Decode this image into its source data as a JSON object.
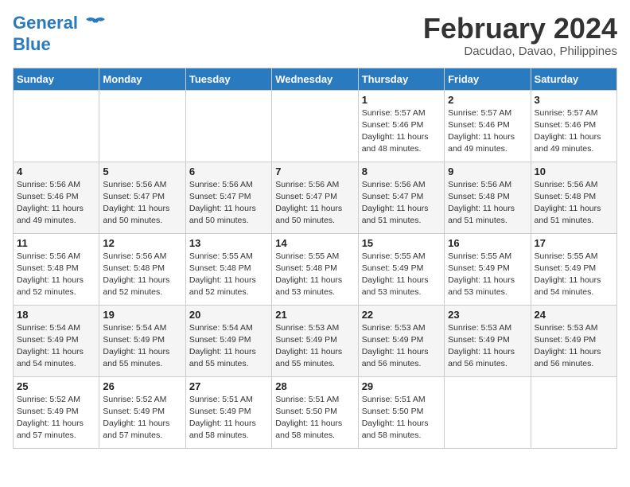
{
  "header": {
    "logo_line1": "General",
    "logo_line2": "Blue",
    "month_year": "February 2024",
    "location": "Dacudao, Davao, Philippines"
  },
  "weekdays": [
    "Sunday",
    "Monday",
    "Tuesday",
    "Wednesday",
    "Thursday",
    "Friday",
    "Saturday"
  ],
  "weeks": [
    [
      {
        "day": "",
        "detail": ""
      },
      {
        "day": "",
        "detail": ""
      },
      {
        "day": "",
        "detail": ""
      },
      {
        "day": "",
        "detail": ""
      },
      {
        "day": "1",
        "detail": "Sunrise: 5:57 AM\nSunset: 5:46 PM\nDaylight: 11 hours\nand 48 minutes."
      },
      {
        "day": "2",
        "detail": "Sunrise: 5:57 AM\nSunset: 5:46 PM\nDaylight: 11 hours\nand 49 minutes."
      },
      {
        "day": "3",
        "detail": "Sunrise: 5:57 AM\nSunset: 5:46 PM\nDaylight: 11 hours\nand 49 minutes."
      }
    ],
    [
      {
        "day": "4",
        "detail": "Sunrise: 5:56 AM\nSunset: 5:46 PM\nDaylight: 11 hours\nand 49 minutes."
      },
      {
        "day": "5",
        "detail": "Sunrise: 5:56 AM\nSunset: 5:47 PM\nDaylight: 11 hours\nand 50 minutes."
      },
      {
        "day": "6",
        "detail": "Sunrise: 5:56 AM\nSunset: 5:47 PM\nDaylight: 11 hours\nand 50 minutes."
      },
      {
        "day": "7",
        "detail": "Sunrise: 5:56 AM\nSunset: 5:47 PM\nDaylight: 11 hours\nand 50 minutes."
      },
      {
        "day": "8",
        "detail": "Sunrise: 5:56 AM\nSunset: 5:47 PM\nDaylight: 11 hours\nand 51 minutes."
      },
      {
        "day": "9",
        "detail": "Sunrise: 5:56 AM\nSunset: 5:48 PM\nDaylight: 11 hours\nand 51 minutes."
      },
      {
        "day": "10",
        "detail": "Sunrise: 5:56 AM\nSunset: 5:48 PM\nDaylight: 11 hours\nand 51 minutes."
      }
    ],
    [
      {
        "day": "11",
        "detail": "Sunrise: 5:56 AM\nSunset: 5:48 PM\nDaylight: 11 hours\nand 52 minutes."
      },
      {
        "day": "12",
        "detail": "Sunrise: 5:56 AM\nSunset: 5:48 PM\nDaylight: 11 hours\nand 52 minutes."
      },
      {
        "day": "13",
        "detail": "Sunrise: 5:55 AM\nSunset: 5:48 PM\nDaylight: 11 hours\nand 52 minutes."
      },
      {
        "day": "14",
        "detail": "Sunrise: 5:55 AM\nSunset: 5:48 PM\nDaylight: 11 hours\nand 53 minutes."
      },
      {
        "day": "15",
        "detail": "Sunrise: 5:55 AM\nSunset: 5:49 PM\nDaylight: 11 hours\nand 53 minutes."
      },
      {
        "day": "16",
        "detail": "Sunrise: 5:55 AM\nSunset: 5:49 PM\nDaylight: 11 hours\nand 53 minutes."
      },
      {
        "day": "17",
        "detail": "Sunrise: 5:55 AM\nSunset: 5:49 PM\nDaylight: 11 hours\nand 54 minutes."
      }
    ],
    [
      {
        "day": "18",
        "detail": "Sunrise: 5:54 AM\nSunset: 5:49 PM\nDaylight: 11 hours\nand 54 minutes."
      },
      {
        "day": "19",
        "detail": "Sunrise: 5:54 AM\nSunset: 5:49 PM\nDaylight: 11 hours\nand 55 minutes."
      },
      {
        "day": "20",
        "detail": "Sunrise: 5:54 AM\nSunset: 5:49 PM\nDaylight: 11 hours\nand 55 minutes."
      },
      {
        "day": "21",
        "detail": "Sunrise: 5:53 AM\nSunset: 5:49 PM\nDaylight: 11 hours\nand 55 minutes."
      },
      {
        "day": "22",
        "detail": "Sunrise: 5:53 AM\nSunset: 5:49 PM\nDaylight: 11 hours\nand 56 minutes."
      },
      {
        "day": "23",
        "detail": "Sunrise: 5:53 AM\nSunset: 5:49 PM\nDaylight: 11 hours\nand 56 minutes."
      },
      {
        "day": "24",
        "detail": "Sunrise: 5:53 AM\nSunset: 5:49 PM\nDaylight: 11 hours\nand 56 minutes."
      }
    ],
    [
      {
        "day": "25",
        "detail": "Sunrise: 5:52 AM\nSunset: 5:49 PM\nDaylight: 11 hours\nand 57 minutes."
      },
      {
        "day": "26",
        "detail": "Sunrise: 5:52 AM\nSunset: 5:49 PM\nDaylight: 11 hours\nand 57 minutes."
      },
      {
        "day": "27",
        "detail": "Sunrise: 5:51 AM\nSunset: 5:49 PM\nDaylight: 11 hours\nand 58 minutes."
      },
      {
        "day": "28",
        "detail": "Sunrise: 5:51 AM\nSunset: 5:50 PM\nDaylight: 11 hours\nand 58 minutes."
      },
      {
        "day": "29",
        "detail": "Sunrise: 5:51 AM\nSunset: 5:50 PM\nDaylight: 11 hours\nand 58 minutes."
      },
      {
        "day": "",
        "detail": ""
      },
      {
        "day": "",
        "detail": ""
      }
    ]
  ]
}
